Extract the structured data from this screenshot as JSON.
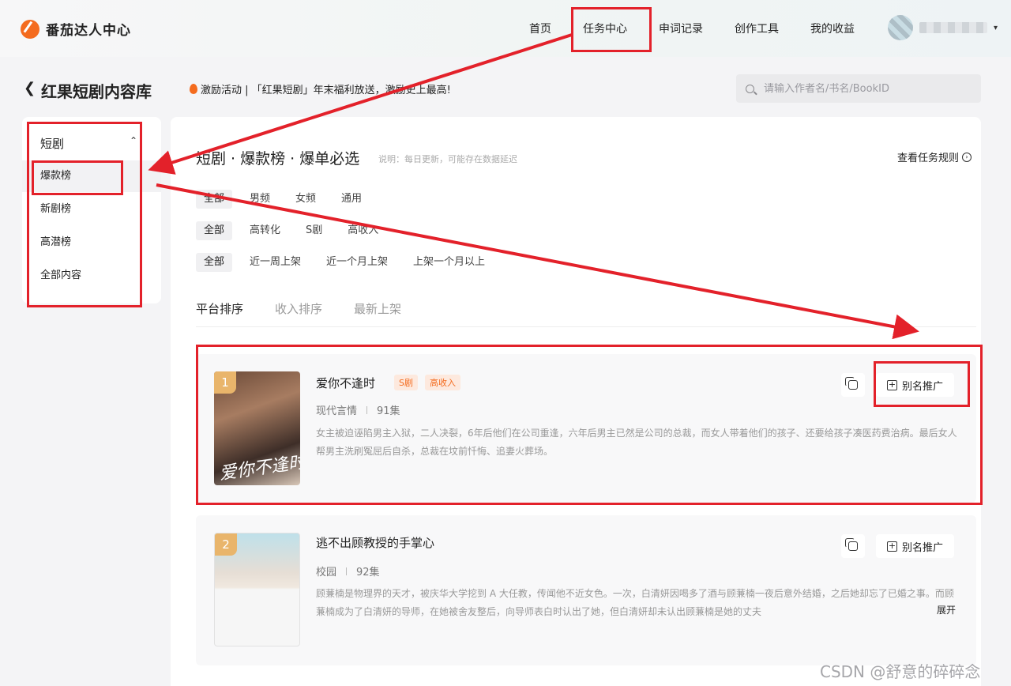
{
  "app": {
    "logo_text": "番茄达人中心"
  },
  "nav": {
    "items": [
      "首页",
      "任务中心",
      "申词记录",
      "创作工具",
      "我的收益"
    ]
  },
  "header": {
    "title": "红果短剧内容库",
    "promo": "激励活动 | 「红果短剧」年末福利放送，激励史上最高!",
    "search_placeholder": "请输入作者名/书名/BookID"
  },
  "sidebar": {
    "group": "短剧",
    "items": [
      "爆款榜",
      "新剧榜",
      "高潜榜",
      "全部内容"
    ]
  },
  "section": {
    "title": "短剧 · 爆款榜 · 爆单必选",
    "note": "说明：每日更新，可能存在数据延迟",
    "rules_link": "查看任务规则"
  },
  "filters": {
    "gender": [
      "全部",
      "男频",
      "女频",
      "通用"
    ],
    "type": [
      "全部",
      "高转化",
      "S剧",
      "高收入"
    ],
    "time": [
      "全部",
      "近一周上架",
      "近一个月上架",
      "上架一个月以上"
    ]
  },
  "sort_tabs": [
    "平台排序",
    "收入排序",
    "最新上架"
  ],
  "cards": [
    {
      "rank": "1",
      "title": "爱你不逢时",
      "tags": [
        "S剧",
        "高收入"
      ],
      "genre": "现代言情",
      "episodes": "91集",
      "description": "女主被迫诬陷男主入狱，二人决裂，6年后他们在公司重逢，六年后男主已然是公司的总裁，而女人带着他们的孩子、还要给孩子凑医药费治病。最后女人帮男主洗刷冤屈后自杀，总裁在坟前忏悔、追妻火葬场。",
      "cover_text": "爱你不逢时",
      "promo_button": "别名推广"
    },
    {
      "rank": "2",
      "title": "逃不出顾教授的手掌心",
      "tags": [],
      "genre": "校园",
      "episodes": "92集",
      "description": "顾蒹楠是物理界的天才，被庆华大学挖到 A 大任教，传闻他不近女色。一次，白清妍因喝多了酒与顾蒹楠一夜后意外结婚，之后她却忘了已婚之事。而顾蒹楠成为了白清妍的导师，在她被舍友整后，向导师表白时认出了她，但白清妍却未认出顾蒹楠是她的丈夫",
      "expand": "展开",
      "promo_button": "别名推广"
    }
  ],
  "watermark": "CSDN @舒意的碎碎念",
  "colors": {
    "accent": "#f46b1e",
    "annotation": "#e3212a",
    "rank_badge": "#e9b56b"
  }
}
